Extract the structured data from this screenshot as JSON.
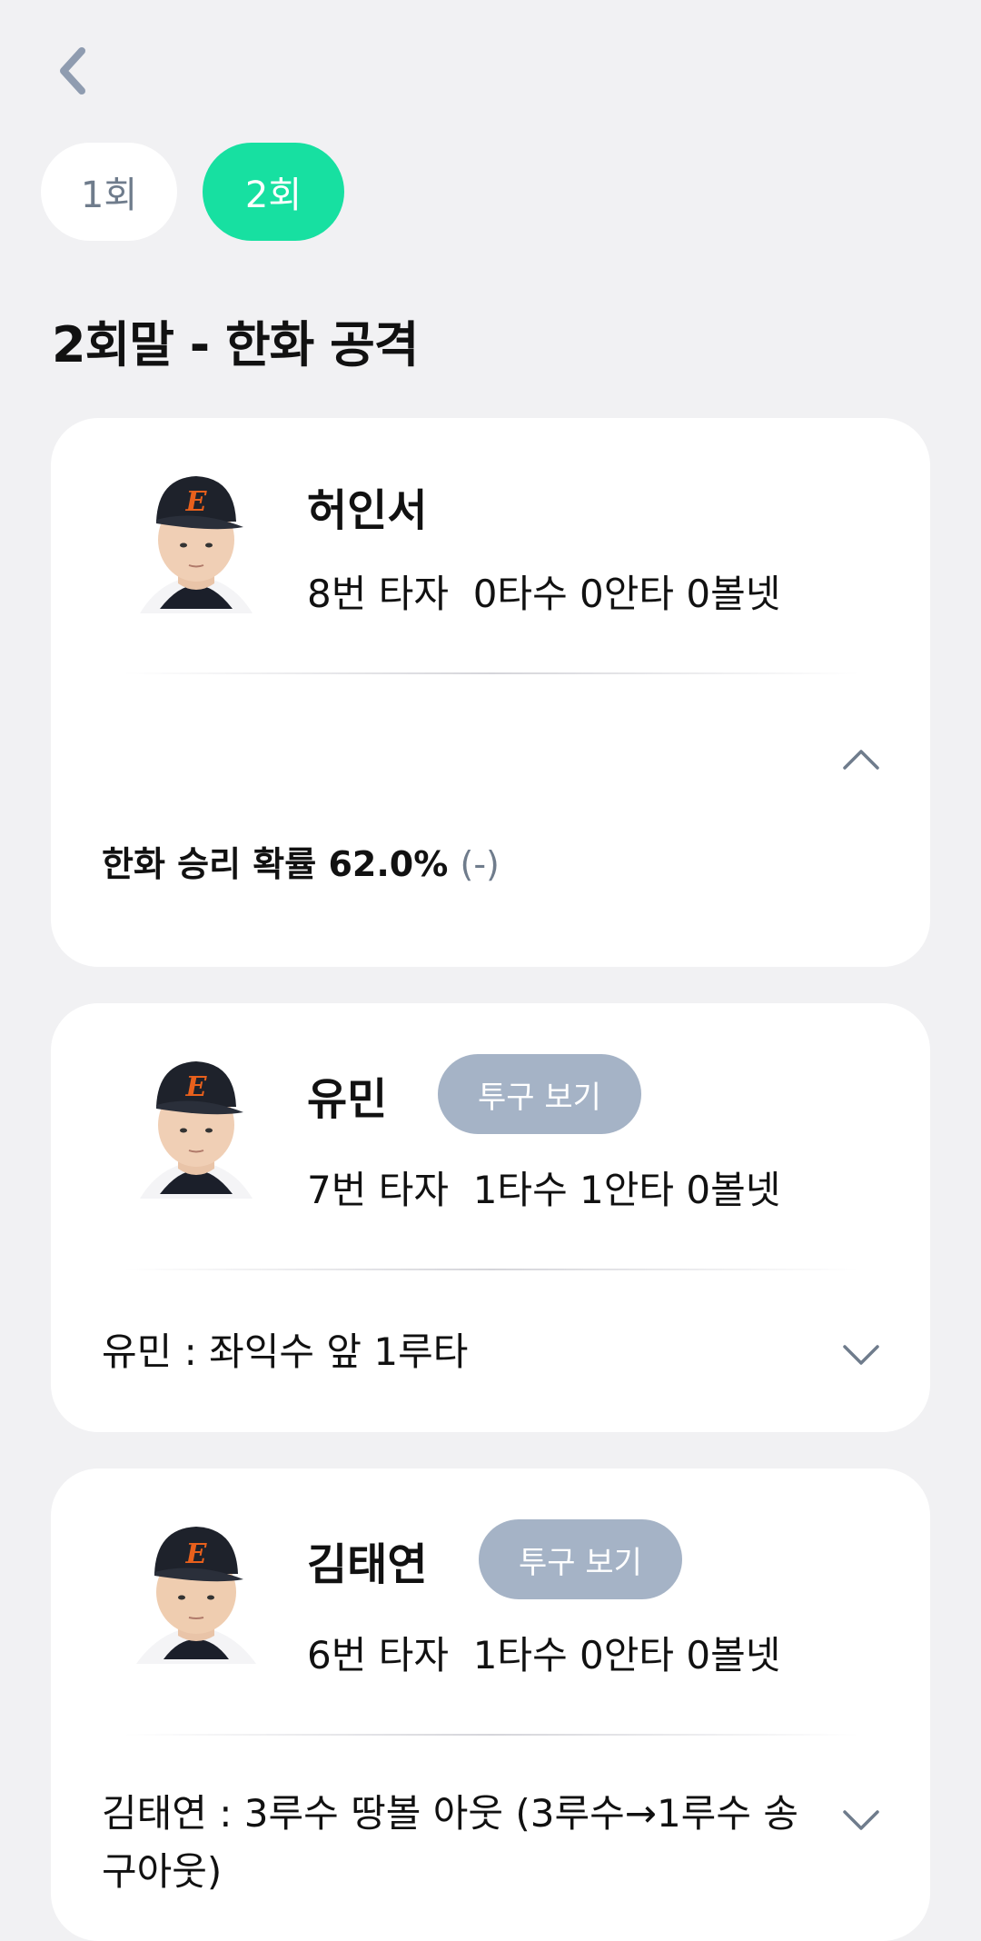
{
  "nav": {
    "back_icon": "chevron-left-icon"
  },
  "innings_tabs": [
    {
      "label": "1회",
      "active": false
    },
    {
      "label": "2회",
      "active": true
    }
  ],
  "section_title": "2회말 - 한화 공격",
  "colors": {
    "accent": "#17e0a1",
    "pitch_button": "#a5b3c6",
    "muted_text": "#6f7c8c",
    "cap_orange": "#e8601c"
  },
  "batters": [
    {
      "name": "허인서",
      "order": "8번 타자",
      "stats": "0타수 0안타 0볼넷",
      "pitch_button": null,
      "expanded": true,
      "win_probability_label": "한화 승리 확률 62.0%",
      "win_probability_change": "(-)",
      "win_probability": 62.0
    },
    {
      "name": "유민",
      "order": "7번 타자",
      "stats": "1타수 1안타 0볼넷",
      "pitch_button": "투구 보기",
      "expanded": false,
      "play_description": "유민 : 좌익수 앞 1루타"
    },
    {
      "name": "김태연",
      "order": "6번 타자",
      "stats": "1타수 0안타 0볼넷",
      "pitch_button": "투구 보기",
      "expanded": false,
      "play_description": "김태연 : 3루수 땅볼 아웃 (3루수→1루수 송구아웃)"
    }
  ]
}
